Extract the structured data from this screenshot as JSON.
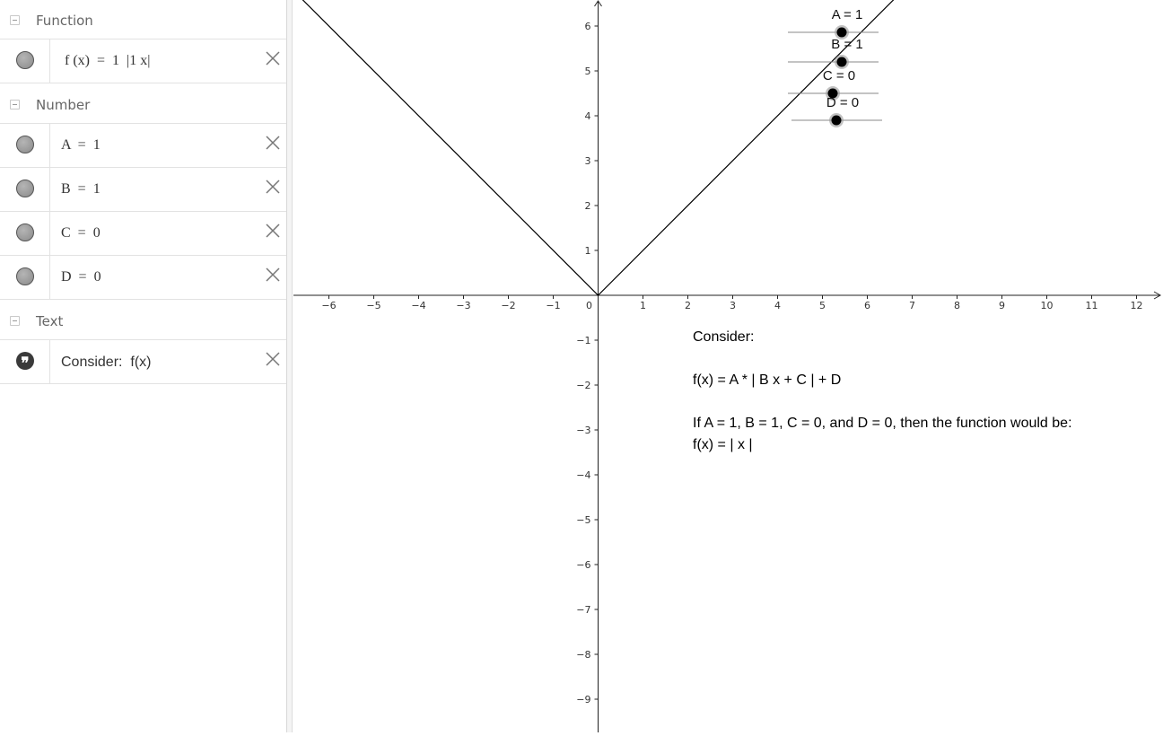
{
  "algebra": {
    "groups": {
      "function": "Function",
      "number": "Number",
      "text": "Text"
    },
    "function_row": "f (x)  =  1  |1 x|",
    "number_rows": [
      "A  =  1",
      "B  =  1",
      "C  =  0",
      "D  =  0"
    ],
    "text_row": "Consider:  f(x)"
  },
  "graph": {
    "x_ticks": [
      "−6",
      "−5",
      "−4",
      "−3",
      "−2",
      "−1",
      "0",
      "1",
      "2",
      "3",
      "4",
      "5",
      "6",
      "7",
      "8",
      "9",
      "10",
      "11",
      "12"
    ],
    "y_ticks_pos": [
      "6",
      "5",
      "4",
      "3",
      "2",
      "1"
    ],
    "y_ticks_neg": [
      "−1",
      "−2",
      "−3",
      "−4",
      "−5",
      "−6",
      "−7",
      "−8",
      "−9"
    ],
    "sliders": [
      {
        "label": "A = 1"
      },
      {
        "label": "B = 1"
      },
      {
        "label": "C = 0"
      },
      {
        "label": "D = 0"
      }
    ]
  },
  "text_object": {
    "line1": "Consider:",
    "line2": "",
    "line3": "f(x) = A * | B x + C | + D",
    "line4": "",
    "line5": "If A = 1, B = 1, C = 0, and D = 0, then the function would be:",
    "line6": "f(x) = | x |"
  },
  "chart_data": {
    "type": "line",
    "series": [
      {
        "x": [
          -6.8,
          0,
          6.6
        ],
        "y": [
          6.8,
          0,
          6.6
        ]
      }
    ],
    "xlim": [
      -6.8,
      12.5
    ],
    "ylim": [
      -9.7,
      6.6
    ],
    "grid": false
  }
}
